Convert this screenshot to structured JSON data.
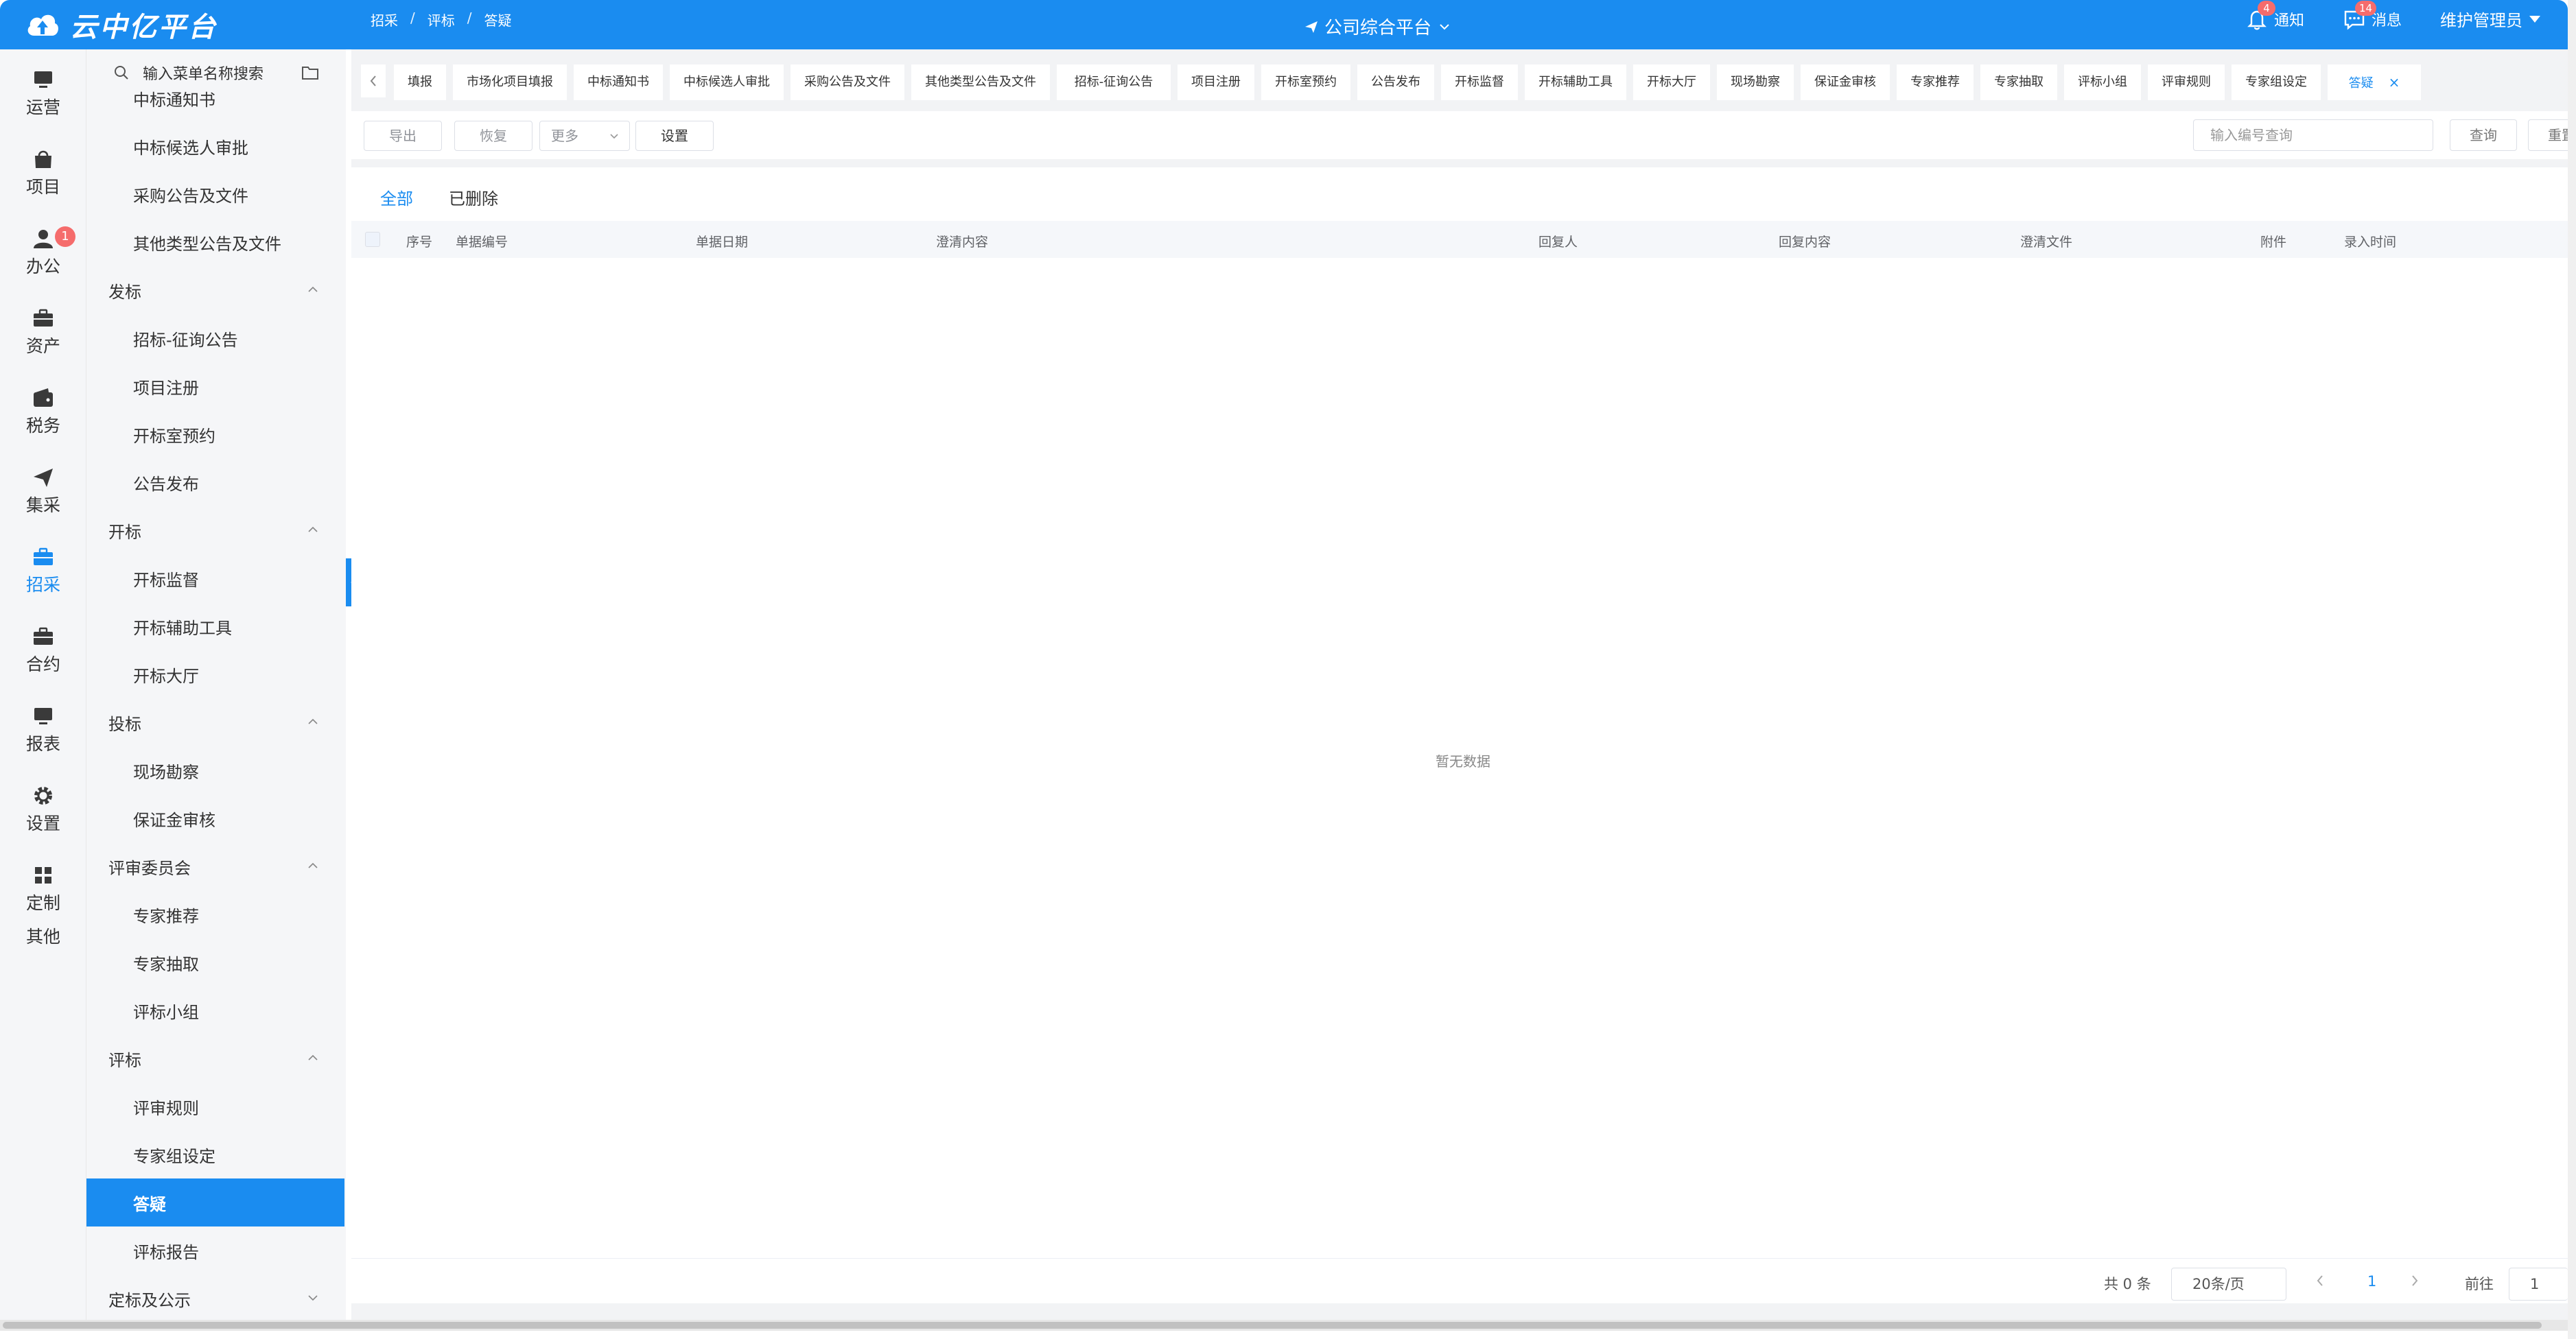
{
  "header": {
    "logo_text": "云中亿平台",
    "breadcrumb": [
      "招采",
      "评标",
      "答疑"
    ],
    "breadcrumb_sep": "/",
    "platform": "公司综合平台",
    "notice_label": "通知",
    "notice_count": "4",
    "message_label": "消息",
    "message_count": "14",
    "user": "维护管理员"
  },
  "rail": {
    "items": [
      {
        "label": "运营",
        "icon": "monitor-icon"
      },
      {
        "label": "项目",
        "icon": "bag-icon"
      },
      {
        "label": "办公",
        "icon": "user-icon",
        "badge": "1"
      },
      {
        "label": "资产",
        "icon": "briefcase-icon"
      },
      {
        "label": "税务",
        "icon": "wallet-icon"
      },
      {
        "label": "集采",
        "icon": "send-icon"
      },
      {
        "label": "招采",
        "icon": "briefcase-icon",
        "active": true
      },
      {
        "label": "合约",
        "icon": "briefcase-icon"
      },
      {
        "label": "报表",
        "icon": "monitor-icon"
      },
      {
        "label": "设置",
        "icon": "gear-icon"
      },
      {
        "label": "定制",
        "icon": "grid-icon"
      },
      {
        "label": "其他",
        "icon": ""
      }
    ]
  },
  "submenu": {
    "search_placeholder": "输入菜单名称搜索",
    "entries": [
      {
        "label": "中标通知书",
        "type": "child"
      },
      {
        "label": "中标候选人审批",
        "type": "child"
      },
      {
        "label": "采购公告及文件",
        "type": "child"
      },
      {
        "label": "其他类型公告及文件",
        "type": "child"
      },
      {
        "label": "发标",
        "type": "group"
      },
      {
        "label": "招标-征询公告",
        "type": "child"
      },
      {
        "label": "项目注册",
        "type": "child"
      },
      {
        "label": "开标室预约",
        "type": "child"
      },
      {
        "label": "公告发布",
        "type": "child"
      },
      {
        "label": "开标",
        "type": "group"
      },
      {
        "label": "开标监督",
        "type": "child"
      },
      {
        "label": "开标辅助工具",
        "type": "child"
      },
      {
        "label": "开标大厅",
        "type": "child"
      },
      {
        "label": "投标",
        "type": "group"
      },
      {
        "label": "现场勘察",
        "type": "child"
      },
      {
        "label": "保证金审核",
        "type": "child"
      },
      {
        "label": "评审委员会",
        "type": "group"
      },
      {
        "label": "专家推荐",
        "type": "child"
      },
      {
        "label": "专家抽取",
        "type": "child"
      },
      {
        "label": "评标小组",
        "type": "child"
      },
      {
        "label": "评标",
        "type": "group"
      },
      {
        "label": "评审规则",
        "type": "child"
      },
      {
        "label": "专家组设定",
        "type": "child"
      },
      {
        "label": "答疑",
        "type": "child",
        "active": true
      },
      {
        "label": "评标报告",
        "type": "child"
      },
      {
        "label": "定标及公示",
        "type": "group",
        "collapsed": true
      }
    ]
  },
  "tabs": [
    {
      "label": "填报"
    },
    {
      "label": "市场化项目填报"
    },
    {
      "label": "中标通知书"
    },
    {
      "label": "中标候选人审批"
    },
    {
      "label": "采购公告及文件"
    },
    {
      "label": "其他类型公告及文件"
    },
    {
      "label": "招标-征询公告"
    },
    {
      "label": "项目注册"
    },
    {
      "label": "开标室预约"
    },
    {
      "label": "公告发布"
    },
    {
      "label": "开标监督"
    },
    {
      "label": "开标辅助工具"
    },
    {
      "label": "开标大厅"
    },
    {
      "label": "现场勘察"
    },
    {
      "label": "保证金审核"
    },
    {
      "label": "专家推荐"
    },
    {
      "label": "专家抽取"
    },
    {
      "label": "评标小组"
    },
    {
      "label": "评审规则"
    },
    {
      "label": "专家组设定"
    },
    {
      "label": "答疑",
      "active": true,
      "close": "×"
    }
  ],
  "toolbar": {
    "export": "导出",
    "restore": "恢复",
    "more": "更多",
    "settings": "设置",
    "search_placeholder": "输入编号查询",
    "query": "查询",
    "reset": "重置"
  },
  "subtabs": {
    "all": "全部",
    "deleted": "已删除"
  },
  "table": {
    "columns": [
      "序号",
      "单据编号",
      "单据日期",
      "澄清内容",
      "回复人",
      "回复内容",
      "澄清文件",
      "附件",
      "录入时间"
    ],
    "empty_text": "暂无数据"
  },
  "pagination": {
    "total": "共 0 条",
    "page_size": "20条/页",
    "current_page": "1",
    "goto_label": "前往",
    "goto_value": "1"
  },
  "colors": {
    "accent": "#1a8cf0",
    "badge": "#f56c6c"
  }
}
